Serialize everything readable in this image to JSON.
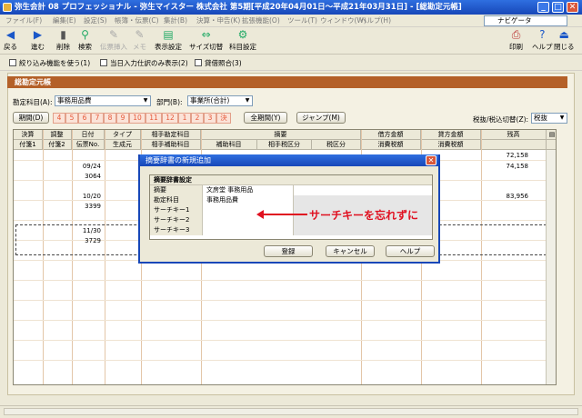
{
  "window": {
    "title": "弥生会計 08 プロフェッショナル - 弥生マイスター 株式会社 第5期[平成20年04月01日～平成21年03月31日] - [総勘定元帳]",
    "min": "_",
    "max": "□",
    "close": "✕"
  },
  "menu": [
    "ファイル(F)",
    "編集(E)",
    "設定(S)",
    "帳簿・伝票(C)",
    "集計(B)",
    "決算・申告(K)",
    "拡張機能(O)",
    "ツール(T)",
    "ウィンドウ(W)",
    "ヘルプ(H)"
  ],
  "navigator": "ナビゲータ",
  "toolbar": {
    "back": "戻る",
    "forward": "進む",
    "delete": "削除",
    "search": "検索",
    "compound": "伝票挿入",
    "memo": "メモ",
    "display_settings": "表示設定",
    "size_switch": "サイズ切替",
    "account_settings": "科目設定",
    "print": "印刷",
    "help": "ヘルプ",
    "close": "閉じる"
  },
  "options": {
    "narrow": "絞り込み機能を使う(1)",
    "today_only": "当日入力仕訳のみ表示(2)",
    "multi_match": "貸借照合(3)"
  },
  "ledger": {
    "heading": "総勘定元帳",
    "account_label": "勘定科目(A):",
    "account_value": "事務用品費",
    "dept_label": "部門(B):",
    "dept_value": "事業所(合計)",
    "period_button": "期間(D)",
    "months": [
      "4",
      "5",
      "6",
      "7",
      "8",
      "9",
      "10",
      "11",
      "12",
      "1",
      "2",
      "3",
      "決"
    ],
    "all_period_button": "全期間(Y)",
    "jump_button": "ジャンプ(M)",
    "tax_label": "税抜/税込切替(Z):",
    "tax_value": "税抜"
  },
  "columns_top": [
    "決算",
    "調整",
    "日付",
    "タイプ",
    "相手勘定科目",
    "摘要",
    "借方金額",
    "貸方金額",
    "残高"
  ],
  "columns_bottom": [
    "付箋1",
    "付箋2",
    "伝票No.",
    "生成元",
    "相手補助科目",
    "補助科目",
    "相手税区分",
    "税区分",
    "消費税額",
    "消費税額"
  ],
  "rows": [
    {
      "date": "",
      "no": "",
      "balance": "72,158"
    },
    {
      "date": "09/24",
      "no": "3064",
      "balance": "74,158"
    },
    {
      "date": "10/20",
      "no": "3399",
      "balance": "83,956"
    },
    {
      "date": "11/30",
      "no": "3729",
      "balance": ""
    }
  ],
  "dialog": {
    "title": "摘要辞書の新規追加",
    "section": "摘要辞書設定",
    "fields": [
      {
        "label": "摘要",
        "value": "文房堂 事務用品"
      },
      {
        "label": "勘定科目",
        "value": "事務用品費"
      },
      {
        "label": "サーチキー1",
        "value": ""
      },
      {
        "label": "サーチキー2",
        "value": ""
      },
      {
        "label": "サーチキー3",
        "value": ""
      }
    ],
    "register": "登録",
    "cancel": "キャンセル",
    "help": "ヘルプ"
  },
  "annotation": "サーチキーを忘れずに",
  "colors": {
    "accent": "#1747b8",
    "ledger_head": "#b46028",
    "annotation": "#e01020",
    "period_month": "#e65a3a"
  }
}
